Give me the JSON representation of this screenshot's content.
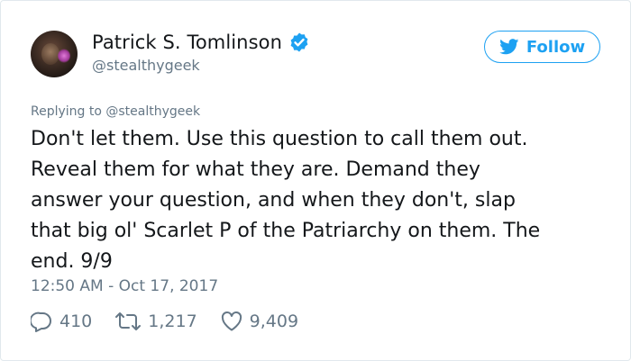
{
  "author": {
    "display_name": "Patrick S. Tomlinson",
    "handle": "@stealthygeek",
    "verified": true
  },
  "follow_button": {
    "label": "Follow"
  },
  "reply_context": {
    "prefix": "Replying to ",
    "target": "@stealthygeek"
  },
  "tweet": {
    "text": "Don't let them. Use this question to call them out.\nReveal them for what they are. Demand they\nanswer your question, and when they don't, slap\nthat big ol' Scarlet P of the Patriarchy on them. The\nend. 9/9",
    "timestamp": "12:50 AM - Oct 17, 2017"
  },
  "stats": {
    "replies": "410",
    "retweets": "1,217",
    "likes": "9,409"
  },
  "colors": {
    "accent": "#1da1f2",
    "text": "#14171a",
    "muted": "#657786",
    "border": "#e1e8ed"
  },
  "icons": {
    "verified": "verified-badge-icon",
    "follow": "twitter-bird-icon",
    "reply": "reply-bubble-icon",
    "retweet": "retweet-icon",
    "like": "heart-icon"
  }
}
